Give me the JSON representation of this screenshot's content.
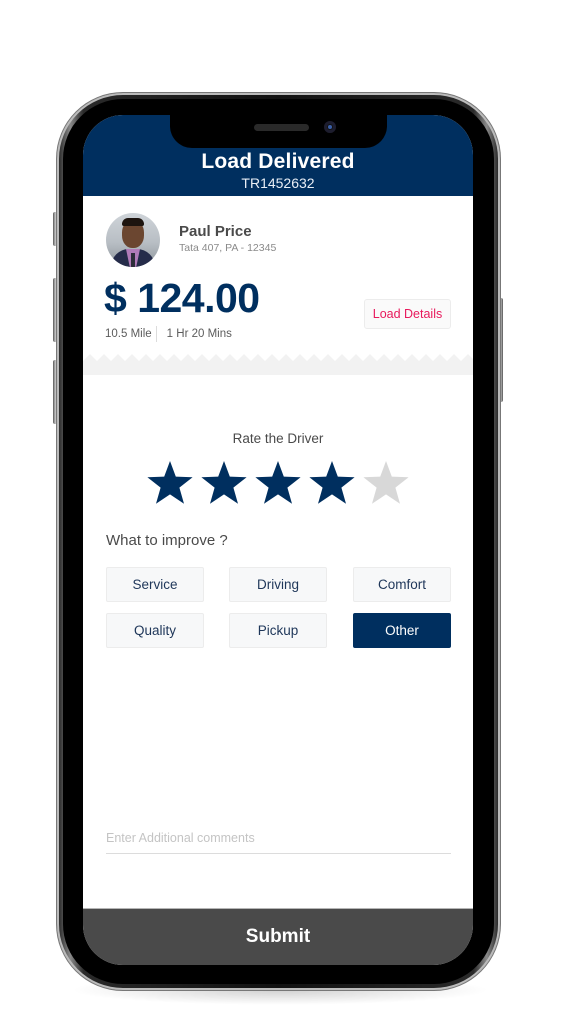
{
  "header": {
    "title": "Load Delivered",
    "load_id": "TR1452632"
  },
  "driver": {
    "name": "Paul Price",
    "address": "Tata 407, PA - 12345",
    "avatar": "driver-photo"
  },
  "trip": {
    "amount": "$ 124.00",
    "distance": "10.5 Mile",
    "duration": "1 Hr 20 Mins",
    "load_details_label": "Load Details"
  },
  "rating": {
    "label": "Rate the Driver",
    "value": 4,
    "max": 5,
    "filled_color": "#002f5f",
    "empty_color": "#d8d8d8"
  },
  "improve": {
    "label": "What to improve ?",
    "options": [
      {
        "label": "Service",
        "selected": false
      },
      {
        "label": "Driving",
        "selected": false
      },
      {
        "label": "Comfort",
        "selected": false
      },
      {
        "label": "Quality",
        "selected": false
      },
      {
        "label": "Pickup",
        "selected": false
      },
      {
        "label": "Other",
        "selected": true
      }
    ]
  },
  "comment": {
    "placeholder": "Enter Additional comments",
    "value": ""
  },
  "submit_label": "Submit",
  "colors": {
    "brand_navy": "#002f5f",
    "accent_pink": "#e8195c",
    "submit_bg": "#4a4a4a"
  }
}
